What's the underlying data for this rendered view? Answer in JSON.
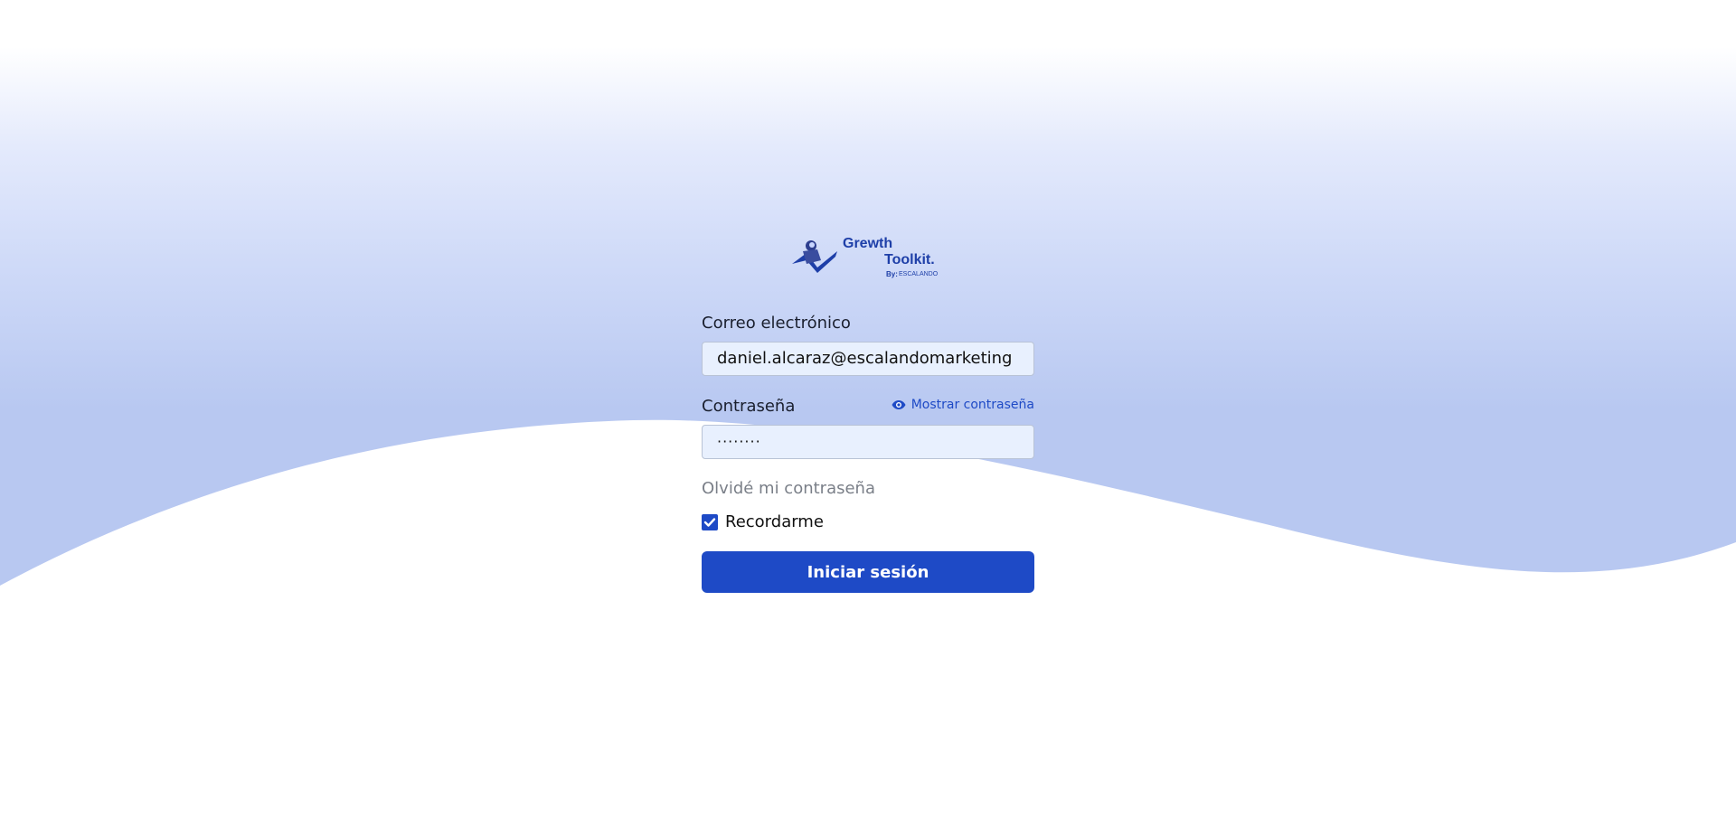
{
  "logo": {
    "line1": "Grewth",
    "line2": "Toolkit.",
    "byline_prefix": "By:",
    "byline_brand": "ESCALANDO",
    "icon": "logo-astronaut-icon"
  },
  "form": {
    "email_label": "Correo electrónico",
    "email_value": "daniel.alcaraz@escalandomarketing",
    "password_label": "Contraseña",
    "password_value": "········",
    "show_password_label": "Mostrar contraseña",
    "show_password_icon": "eye-icon",
    "forgot_label": "Olvidé mi contraseña",
    "remember_label": "Recordarme",
    "remember_checked": true,
    "submit_label": "Iniciar sesión"
  },
  "colors": {
    "accent": "#1e4ac6",
    "wave_top": "#ffffff",
    "wave_bottom": "#b8c8f1"
  }
}
